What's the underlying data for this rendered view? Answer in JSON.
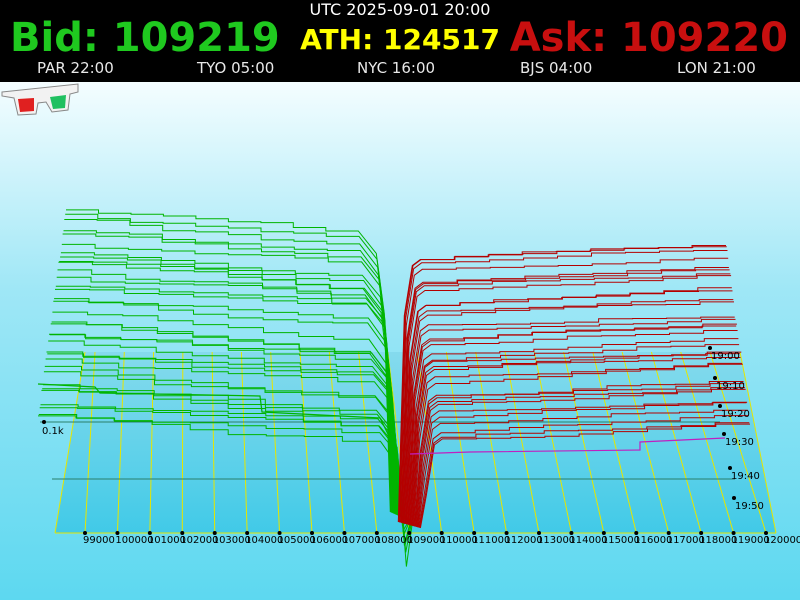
{
  "header": {
    "utc": "UTC 2025-09-01 20:00",
    "bid": "Bid: 109219",
    "ath": "ATH: 124517",
    "ask": "Ask: 109220",
    "clocks": [
      "PAR 22:00",
      "TYO 05:00",
      "NYC 16:00",
      "BJS 04:00",
      "LON 21:00"
    ]
  },
  "colors": {
    "bid": "#1fc91f",
    "ath": "#ffff00",
    "ask": "#c80f0f",
    "bid_lines": "#00b400",
    "ask_lines": "#b40000",
    "marker_line": "#c020c0",
    "grid": "#e6e600"
  },
  "chart_data": {
    "type": "line",
    "x_tick_labels": [
      "99000",
      "100000",
      "101000",
      "102000",
      "103000",
      "104000",
      "105000",
      "106000",
      "107000",
      "108000",
      "109000",
      "110000",
      "111000",
      "112000",
      "113000",
      "114000",
      "115000",
      "116000",
      "117000",
      "118000",
      "119000",
      "120000"
    ],
    "x_range": [
      99000,
      120000
    ],
    "mid_price": 109219.5,
    "depth_label": "0.1k",
    "time_labels": [
      "19:00",
      "19:10",
      "19:20",
      "19:30",
      "19:40",
      "19:50"
    ],
    "series": [
      {
        "name": "",
        "side": "bid"
      },
      {
        "name": "",
        "side": "ask"
      }
    ]
  },
  "icons": {
    "glasses": "3d-glasses-icon"
  }
}
